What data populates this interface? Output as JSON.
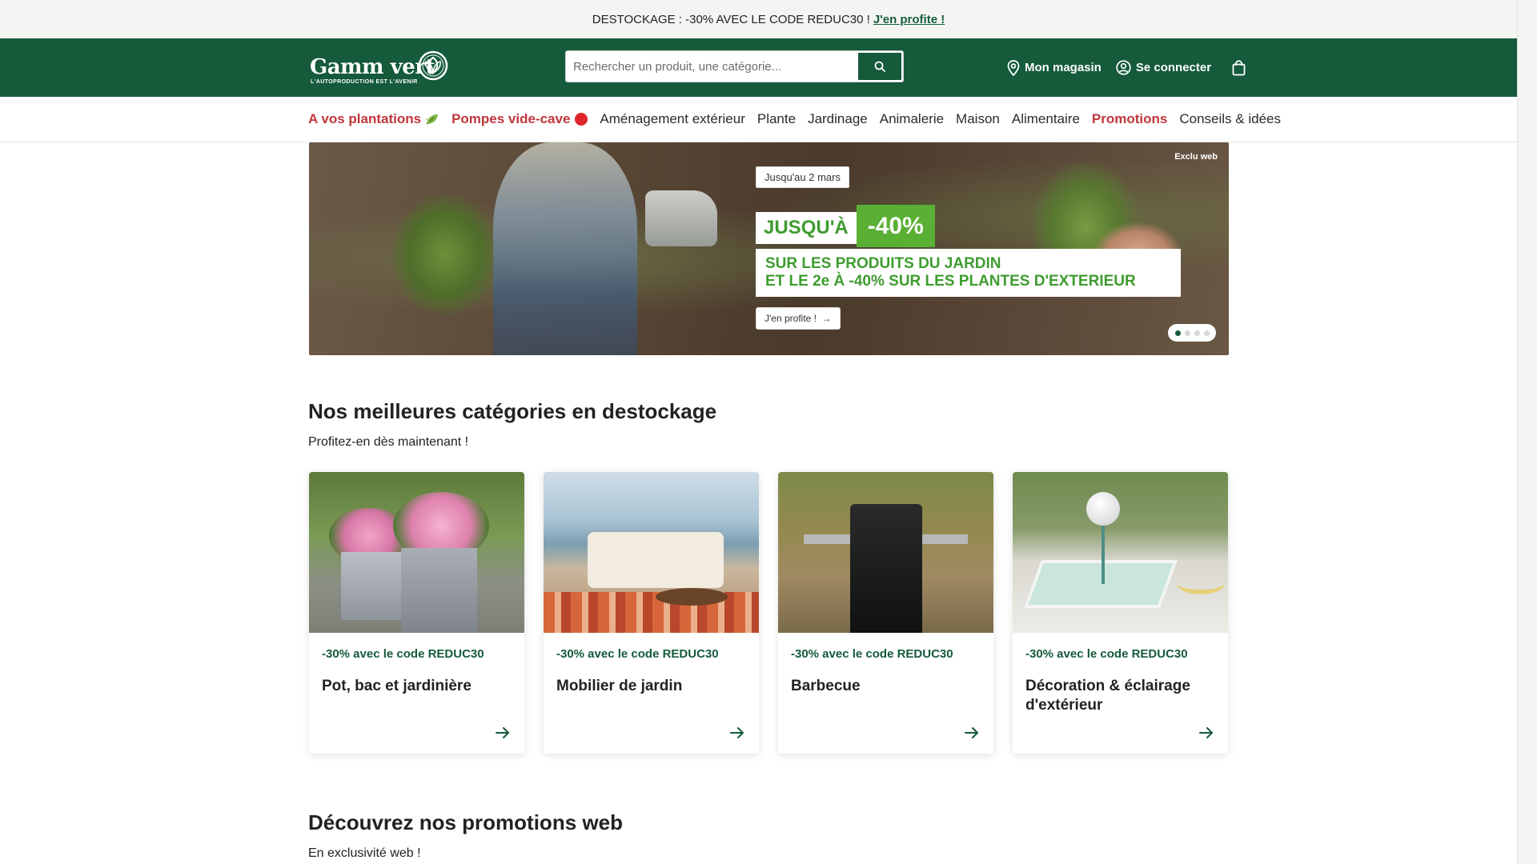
{
  "announcement": {
    "text": "DESTOCKAGE : -30% AVEC LE CODE REDUC30 !",
    "link": "J'en profite !"
  },
  "header": {
    "logo_text": "Gamm vert",
    "logo_tagline": "L'AUTOPRODUCTION EST L'AVENIR",
    "search_placeholder": "Rechercher un produit, une catégorie...",
    "store_label": "Mon magasin",
    "login_label": "Se connecter"
  },
  "nav": {
    "items": [
      {
        "label": "A vos plantations",
        "highlight": true
      },
      {
        "label": "Pompes vide-cave",
        "highlight": true
      },
      {
        "label": "Aménagement extérieur",
        "highlight": false
      },
      {
        "label": "Plante",
        "highlight": false
      },
      {
        "label": "Jardinage",
        "highlight": false
      },
      {
        "label": "Animalerie",
        "highlight": false
      },
      {
        "label": "Maison",
        "highlight": false
      },
      {
        "label": "Alimentaire",
        "highlight": false
      },
      {
        "label": "Promotions",
        "highlight": true
      },
      {
        "label": "Conseils & idées",
        "highlight": false
      }
    ]
  },
  "hero": {
    "date_label": "Jusqu'au 2 mars",
    "headline_prefix": "JUSQU'À",
    "headline_percent": "-40%",
    "body_line1": "SUR LES PRODUITS DU JARDIN",
    "body_line2": "ET LE 2e À -40% SUR LES PLANTES D'EXTERIEUR",
    "cta_label": "J'en profite !",
    "badge": "Exclu web",
    "slide_count": 4,
    "active_slide": 1
  },
  "section_destockage": {
    "title": "Nos meilleures catégories en destockage",
    "subtitle": "Profitez-en dès maintenant !",
    "cards": [
      {
        "promo": "-30% avec le code REDUC30",
        "title": "Pot, bac et jardinière"
      },
      {
        "promo": "-30% avec le code REDUC30",
        "title": "Mobilier de jardin"
      },
      {
        "promo": "-30% avec le code REDUC30",
        "title": "Barbecue"
      },
      {
        "promo": "-30% avec le code REDUC30",
        "title": "Décoration & éclairage d'extérieur"
      }
    ]
  },
  "section_web": {
    "title": "Découvrez nos promotions web",
    "subtitle": "En exclusivité web !"
  },
  "colors": {
    "brand_green": "#145a3b",
    "promo_red": "#c0363b",
    "hero_green": "#5ab034"
  },
  "icons": [
    "search-icon",
    "location-pin-icon",
    "user-icon",
    "shopping-bag-icon",
    "leaf-icon",
    "arrow-right-icon"
  ]
}
